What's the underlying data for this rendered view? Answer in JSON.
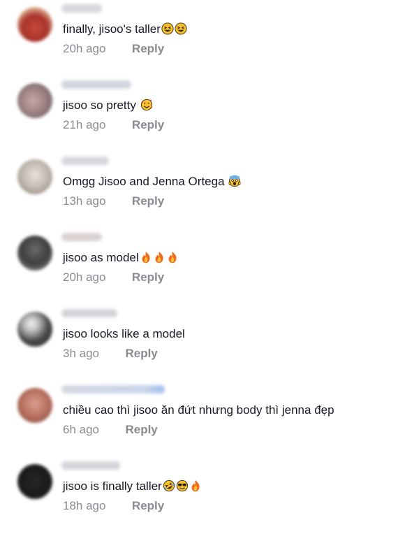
{
  "comments": [
    {
      "text": "finally, jisoo's taller",
      "time": "20h ago",
      "reply": "Reply",
      "emojis": [
        "grinning-squint",
        "grinning-squint"
      ]
    },
    {
      "text": "jisoo so pretty ",
      "time": "21h ago",
      "reply": "Reply",
      "emojis": [
        "smiling-hearts"
      ]
    },
    {
      "text": "Omgg Jisoo and Jenna Ortega ",
      "time": "13h ago",
      "reply": "Reply",
      "emojis": [
        "screaming-fear"
      ]
    },
    {
      "text": "jisoo as model",
      "time": "20h ago",
      "reply": "Reply",
      "emojis": [
        "fire",
        "fire",
        "fire"
      ]
    },
    {
      "text": "jisoo looks like a model",
      "time": "3h ago",
      "reply": "Reply",
      "emojis": []
    },
    {
      "text": "chiều cao thì jisoo ăn đứt nhưng body thì jenna đẹp",
      "time": "6h ago",
      "reply": "Reply",
      "emojis": []
    },
    {
      "text": "jisoo is finally taller",
      "time": "18h ago",
      "reply": "Reply",
      "emojis": [
        "rolling-laughing",
        "sunglasses",
        "fire"
      ]
    }
  ],
  "colors": {
    "text": "#161823",
    "meta": "#8a8b91",
    "emoji_face": "#f7c02c",
    "fire": "#f06a1a"
  }
}
